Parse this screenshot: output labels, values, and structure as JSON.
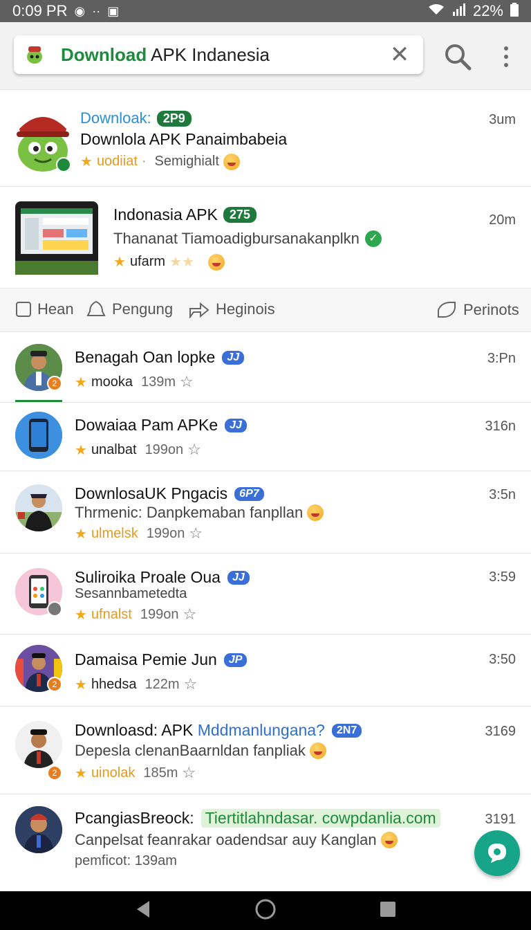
{
  "status_bar": {
    "time": "0:09 PR",
    "battery": "22%"
  },
  "search": {
    "brand": "Download",
    "rest": " APK Indanesia"
  },
  "featured": [
    {
      "label": "Downloak:",
      "badge": "2P9",
      "title": "Downlola APK Panaimbabeia",
      "meta_orange": "uodiiat",
      "meta_sep": "·",
      "meta_gray": "Semighialt",
      "time": "3um"
    },
    {
      "title": "Indonasia APK",
      "badge": "275",
      "subtitle": "Thananat Tiamoadigbursanakanplkn",
      "meta": "ufarm",
      "time": "20m"
    }
  ],
  "filters": [
    {
      "label": "Hean",
      "icon": "square-icon"
    },
    {
      "label": "Pengung",
      "icon": "bell-icon"
    },
    {
      "label": "Heginois",
      "icon": "share-icon"
    },
    {
      "label": "Perinots",
      "icon": "tag-icon"
    }
  ],
  "rows": [
    {
      "title": "Benagah Oan lopke",
      "badge": "JJ",
      "meta_name": "mooka",
      "meta_size": "139m",
      "time": "3:Pn",
      "badge_count": "2"
    },
    {
      "title": "Dowaiaa Pam APKe",
      "badge": "JJ",
      "meta_name": "unalbat",
      "meta_size": "199on",
      "time": "316n"
    },
    {
      "title": "DownlosaUK Pngacis",
      "badge": "6P7",
      "subtitle": "Thrmenic: Danpkemaban fanpllan",
      "meta_name": "ulmelsk",
      "meta_size": "199on",
      "time": "3:5n"
    },
    {
      "title": "Suliroika Proale Oua",
      "badge": "JJ",
      "subtitle": "Sesannbametedta",
      "meta_name": "ufnalst",
      "meta_size": "199on",
      "time": "3:59"
    },
    {
      "title": "Damaisa Pemie Jun",
      "badge": "JP",
      "meta_name": "hhedsa",
      "meta_size": "122m",
      "time": "3:50",
      "badge_count": "2"
    },
    {
      "title_a": "Downloasd: APK ",
      "title_b": "Mddmanlungana?",
      "badge": "2N7",
      "subtitle": "Depesla clenanBaarnldan fanpliak",
      "meta_name": "uinolak",
      "meta_size": "185m",
      "time": "3169",
      "badge_count": "2"
    },
    {
      "title": "PcangiasBreock:",
      "link": "Tiertitlahndasar. cowpdanlia.com",
      "subtitle": "Canpelsat feanrakar oadendsar auy Kanglan",
      "meta": "pemficot: 139am",
      "time": "3191"
    }
  ],
  "colors": {
    "brand_green": "#1e8a3c",
    "badge_blue": "#3b6fd8",
    "fab": "#17a589"
  }
}
